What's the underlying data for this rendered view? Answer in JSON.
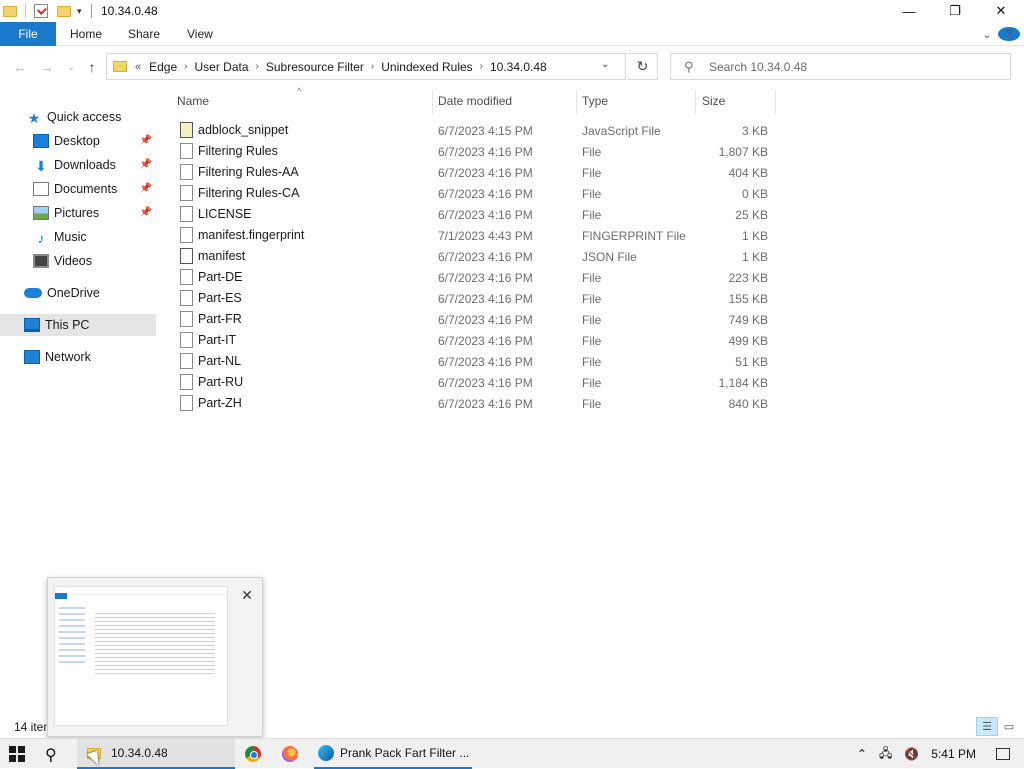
{
  "window": {
    "title": "10.34.0.48"
  },
  "ribbon": {
    "file_label": "File",
    "tabs": [
      "Home",
      "Share",
      "View"
    ]
  },
  "address": {
    "overflow": "«",
    "crumbs": [
      "Edge",
      "User Data",
      "Subresource Filter",
      "Unindexed Rules",
      "10.34.0.48"
    ]
  },
  "search": {
    "placeholder": "Search 10.34.0.48"
  },
  "navpane": {
    "items": [
      {
        "label": "Quick access",
        "icon": "star-icon",
        "pinned": false
      },
      {
        "label": "Desktop",
        "icon": "desktop-icon",
        "pinned": true
      },
      {
        "label": "Downloads",
        "icon": "downloads-icon",
        "pinned": true
      },
      {
        "label": "Documents",
        "icon": "documents-icon",
        "pinned": true
      },
      {
        "label": "Pictures",
        "icon": "pictures-icon",
        "pinned": true
      },
      {
        "label": "Music",
        "icon": "music-icon",
        "pinned": false
      },
      {
        "label": "Videos",
        "icon": "videos-icon",
        "pinned": false
      },
      {
        "label": "OneDrive",
        "icon": "onedrive-icon",
        "pinned": false
      },
      {
        "label": "This PC",
        "icon": "this-pc-icon",
        "pinned": false,
        "selected": true
      },
      {
        "label": "Network",
        "icon": "network-icon",
        "pinned": false
      }
    ]
  },
  "columns": {
    "name": "Name",
    "date": "Date modified",
    "type": "Type",
    "size": "Size"
  },
  "files": [
    {
      "name": "adblock_snippet",
      "date": "6/7/2023 4:15 PM",
      "type": "JavaScript File",
      "size": "3 KB",
      "icon": "javascript-file-icon"
    },
    {
      "name": "Filtering Rules",
      "date": "6/7/2023 4:16 PM",
      "type": "File",
      "size": "1,807 KB",
      "icon": "file-icon"
    },
    {
      "name": "Filtering Rules-AA",
      "date": "6/7/2023 4:16 PM",
      "type": "File",
      "size": "404 KB",
      "icon": "file-icon"
    },
    {
      "name": "Filtering Rules-CA",
      "date": "6/7/2023 4:16 PM",
      "type": "File",
      "size": "0 KB",
      "icon": "file-icon"
    },
    {
      "name": "LICENSE",
      "date": "6/7/2023 4:16 PM",
      "type": "File",
      "size": "25 KB",
      "icon": "file-icon"
    },
    {
      "name": "manifest.fingerprint",
      "date": "7/1/2023 4:43 PM",
      "type": "FINGERPRINT File",
      "size": "1 KB",
      "icon": "file-icon"
    },
    {
      "name": "manifest",
      "date": "6/7/2023 4:16 PM",
      "type": "JSON File",
      "size": "1 KB",
      "icon": "json-file-icon"
    },
    {
      "name": "Part-DE",
      "date": "6/7/2023 4:16 PM",
      "type": "File",
      "size": "223 KB",
      "icon": "file-icon"
    },
    {
      "name": "Part-ES",
      "date": "6/7/2023 4:16 PM",
      "type": "File",
      "size": "155 KB",
      "icon": "file-icon"
    },
    {
      "name": "Part-FR",
      "date": "6/7/2023 4:16 PM",
      "type": "File",
      "size": "749 KB",
      "icon": "file-icon"
    },
    {
      "name": "Part-IT",
      "date": "6/7/2023 4:16 PM",
      "type": "File",
      "size": "499 KB",
      "icon": "file-icon"
    },
    {
      "name": "Part-NL",
      "date": "6/7/2023 4:16 PM",
      "type": "File",
      "size": "51 KB",
      "icon": "file-icon"
    },
    {
      "name": "Part-RU",
      "date": "6/7/2023 4:16 PM",
      "type": "File",
      "size": "1,184 KB",
      "icon": "file-icon"
    },
    {
      "name": "Part-ZH",
      "date": "6/7/2023 4:16 PM",
      "type": "File",
      "size": "840 KB",
      "icon": "file-icon"
    }
  ],
  "status": {
    "count": "14 item"
  },
  "taskbar": {
    "explorer_label": "10.34.0.48",
    "edge_label": "Prank Pack Fart Filter ...",
    "clock": "5:41 PM"
  },
  "colors": {
    "accent": "#1979ca",
    "selected_nav": "#e5e5e5",
    "folder": "#f5d36b"
  }
}
